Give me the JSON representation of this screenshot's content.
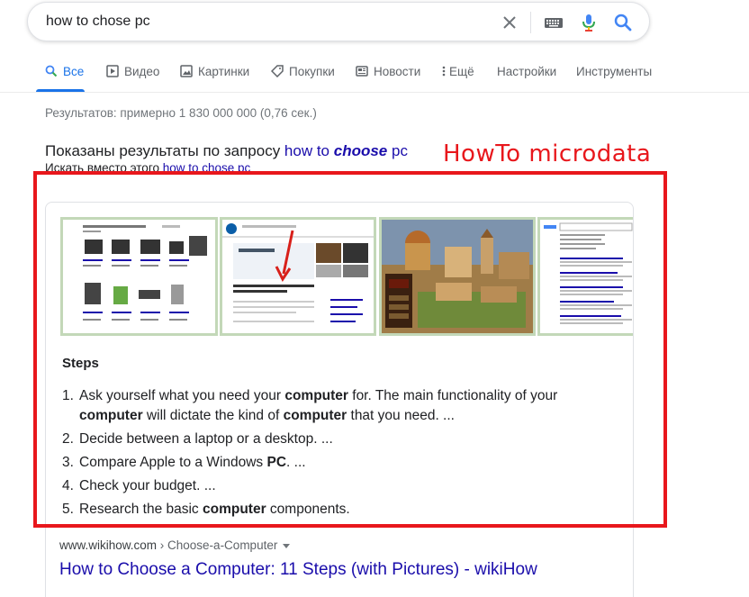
{
  "search": {
    "query": "how to chose pc"
  },
  "tabs": [
    {
      "label": "Все",
      "icon": "search-icon"
    },
    {
      "label": "Видео",
      "icon": "video-icon"
    },
    {
      "label": "Картинки",
      "icon": "image-icon"
    },
    {
      "label": "Покупки",
      "icon": "tag-icon"
    },
    {
      "label": "Новости",
      "icon": "news-icon"
    },
    {
      "label": "Ещё",
      "icon": "more-vert-icon"
    },
    {
      "label": "Настройки"
    },
    {
      "label": "Инструменты"
    }
  ],
  "result_stats": "Результатов: примерно 1 830 000 000 (0,76 сек.)",
  "spell": {
    "showing_prefix": "Показаны результаты по запросу ",
    "corrected_a": "how to ",
    "corrected_b": "choose",
    "corrected_c": " pc",
    "instead_prefix": "Искать вместо этого ",
    "instead_link": "how to chose pc"
  },
  "annotation": "HowTo microdata",
  "snippet": {
    "steps_title": "Steps",
    "steps": [
      {
        "n": "1.",
        "parts": [
          "Ask yourself what you need your ",
          "computer",
          " for. The main functionality of your ",
          "computer",
          " will dictate the kind of ",
          "computer",
          " that you need. ..."
        ]
      },
      {
        "n": "2.",
        "parts": [
          "Decide between a laptop or a desktop. ..."
        ]
      },
      {
        "n": "3.",
        "parts": [
          "Compare Apple to a Windows ",
          "PC",
          ". ..."
        ]
      },
      {
        "n": "4.",
        "parts": [
          "Check your budget. ..."
        ]
      },
      {
        "n": "5.",
        "parts": [
          "Research the basic ",
          "computer",
          " components."
        ]
      }
    ]
  },
  "result": {
    "domain": "www.wikihow.com",
    "breadcrumb": " › Choose-a-Computer",
    "title": "How to Choose a Computer: 11 Steps (with Pictures) - wikiHow"
  },
  "colors": {
    "accent": "#1a73e8",
    "link": "#1a0dab",
    "annotation_red": "#e8171c"
  }
}
